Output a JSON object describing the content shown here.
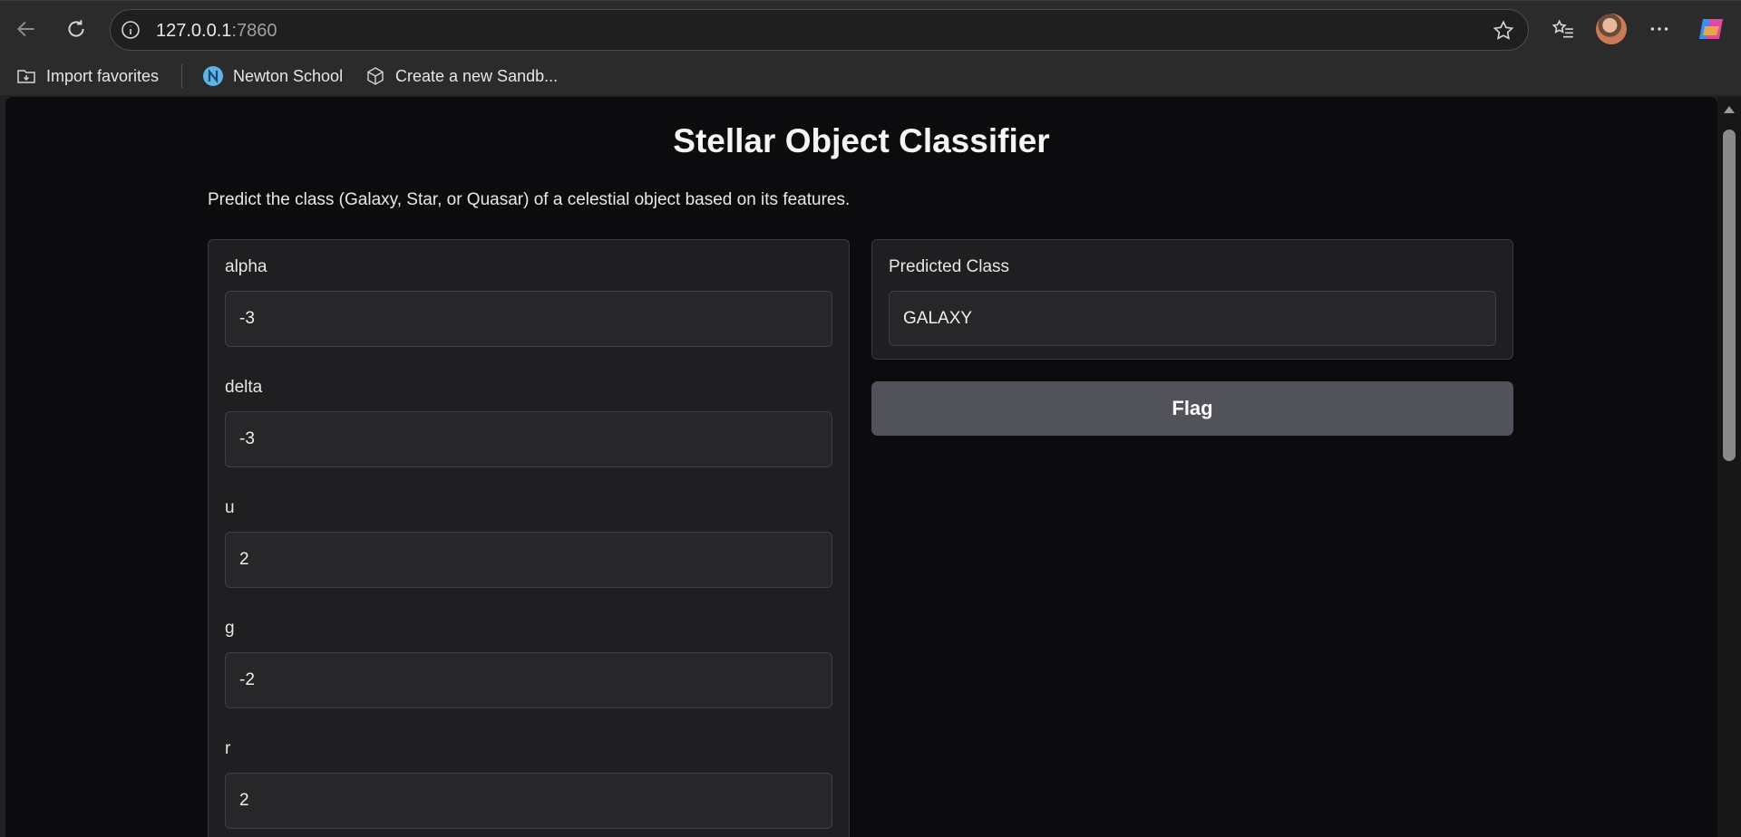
{
  "browser": {
    "url_host": "127.0.0.1",
    "url_port": ":7860",
    "bookmarks": [
      {
        "label": "Import favorites"
      },
      {
        "label": "Newton School"
      },
      {
        "label": "Create a new Sandb..."
      }
    ]
  },
  "app": {
    "title": "Stellar Object Classifier",
    "description": "Predict the class (Galaxy, Star, or Quasar) of a celestial object based on its features.",
    "inputs": [
      {
        "label": "alpha",
        "value": "-3"
      },
      {
        "label": "delta",
        "value": "-3"
      },
      {
        "label": "u",
        "value": "2"
      },
      {
        "label": "g",
        "value": "-2"
      },
      {
        "label": "r",
        "value": "2"
      }
    ],
    "output": {
      "label": "Predicted Class",
      "value": "GALAXY"
    },
    "flag_label": "Flag"
  }
}
